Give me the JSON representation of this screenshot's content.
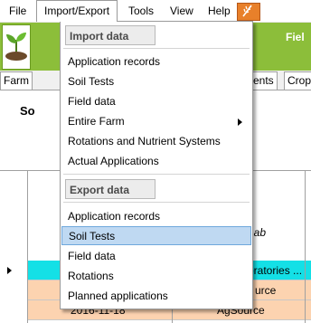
{
  "menubar": {
    "items": [
      "File",
      "Import/Export",
      "Tools",
      "View",
      "Help"
    ]
  },
  "header": {
    "title_partial": "Fiel"
  },
  "tabs": [
    "Farm",
    "ents",
    "Crop"
  ],
  "section": {
    "label_partial": "So"
  },
  "grid": {
    "rows": [
      {
        "date": "",
        "source": "Lab",
        "color": "#ffffff",
        "selected": false
      },
      {
        "date": "",
        "source": "oratories ...",
        "color": "#14e0e6",
        "selected": true
      },
      {
        "date": "",
        "source": "urce",
        "color": "#fcd3b0",
        "selected": false
      },
      {
        "date": "2016-11-18",
        "source": "AgSource",
        "color": "#fcd3b0",
        "selected": false
      }
    ]
  },
  "menu": {
    "import_header": "Import data",
    "import_items": [
      "Application records",
      "Soil Tests",
      "Field data",
      "Entire Farm",
      "Rotations and Nutrient Systems",
      "Actual Applications"
    ],
    "export_header": "Export data",
    "export_items": [
      "Application records",
      "Soil Tests",
      "Field data",
      "Rotations",
      "Planned applications"
    ],
    "highlighted": "Soil Tests"
  }
}
